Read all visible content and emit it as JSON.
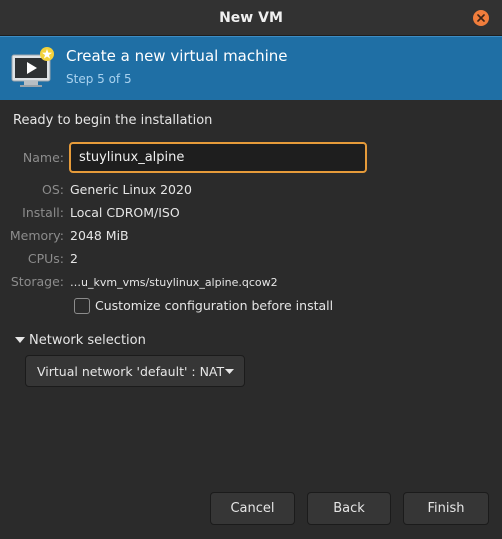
{
  "window": {
    "title": "New VM"
  },
  "header": {
    "title": "Create a new virtual machine",
    "step": "Step 5 of 5"
  },
  "summary": {
    "heading": "Ready to begin the installation",
    "name": {
      "label": "Name:",
      "value": "stuylinux_alpine"
    },
    "os": {
      "label": "OS:",
      "value": "Generic Linux 2020"
    },
    "install": {
      "label": "Install:",
      "value": "Local CDROM/ISO"
    },
    "memory": {
      "label": "Memory:",
      "value": "2048 MiB"
    },
    "cpus": {
      "label": "CPUs:",
      "value": "2"
    },
    "storage": {
      "label": "Storage:",
      "value": "…u_kvm_vms/stuylinux_alpine.qcow2"
    },
    "customize": {
      "label": "Customize configuration before install",
      "checked": false
    }
  },
  "network": {
    "expander_label": "Network selection",
    "selected": "Virtual network 'default' : NAT"
  },
  "buttons": {
    "cancel": "Cancel",
    "back": "Back",
    "finish": "Finish"
  },
  "colors": {
    "header_bg": "#1f6fa5",
    "focus_border": "#e69b3a",
    "close_button": "#f07d3c"
  }
}
